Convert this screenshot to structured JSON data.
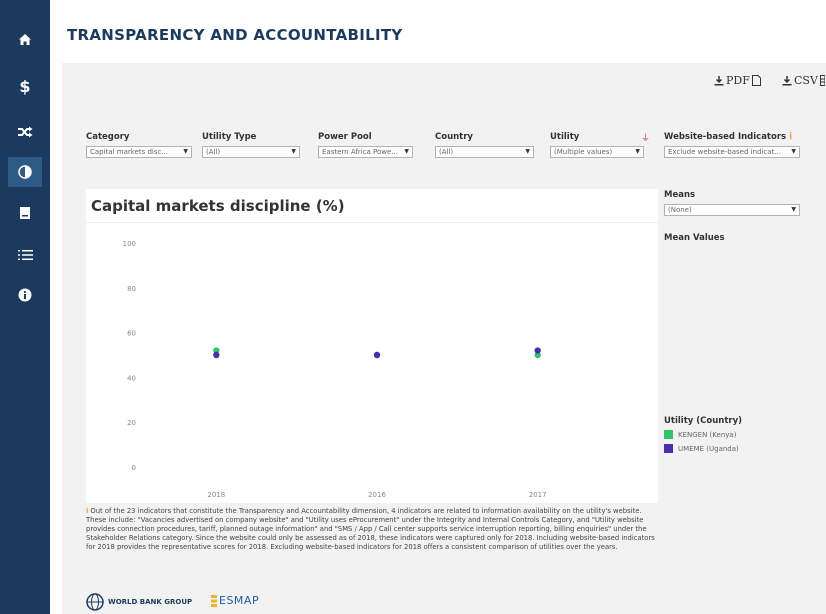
{
  "sidebar": {
    "items": [
      {
        "name": "home-icon",
        "active": false
      },
      {
        "name": "dollar-icon",
        "active": false
      },
      {
        "name": "shuffle-icon",
        "active": false
      },
      {
        "name": "contrast-icon",
        "active": true
      },
      {
        "name": "document-icon",
        "active": false
      },
      {
        "name": "list-icon",
        "active": false
      },
      {
        "name": "info-icon",
        "active": false
      }
    ]
  },
  "page": {
    "title": "TRANSPARENCY AND ACCOUNTABILITY"
  },
  "export": {
    "pdf_label": "PDF",
    "csv_label": "CSV"
  },
  "filters": {
    "category": {
      "label": "Category",
      "value": "Capital markets disc..."
    },
    "utility_type": {
      "label": "Utility Type",
      "value": "(All)"
    },
    "power_pool": {
      "label": "Power Pool",
      "value": "Eastern Africa Powe..."
    },
    "country": {
      "label": "Country",
      "value": "(All)"
    },
    "utility": {
      "label": "Utility",
      "value": "(Multiple values)"
    },
    "website": {
      "label": "Website-based Indicators",
      "info": "i",
      "value": "Exclude website-based indicat..."
    },
    "means": {
      "label": "Means",
      "value": "(None)"
    }
  },
  "mean_values_label": "Mean Values",
  "legend": {
    "title": "Utility (Country)",
    "items": [
      {
        "label": "KENGEN (Kenya)",
        "color": "#2fc46b"
      },
      {
        "label": "UMEME (Uganda)",
        "color": "#4b2ea8"
      }
    ]
  },
  "chart_data": {
    "type": "scatter",
    "title": "Capital markets discipline (%)",
    "categories": [
      "2018",
      "2016",
      "2017"
    ],
    "ylim": [
      0,
      100
    ],
    "yticks": [
      0,
      20,
      40,
      60,
      80,
      100
    ],
    "grid": false,
    "series": [
      {
        "name": "KENGEN (Kenya)",
        "color": "#2fc46b",
        "values": [
          52,
          50,
          50
        ]
      },
      {
        "name": "UMEME (Uganda)",
        "color": "#4b2ea8",
        "values": [
          50,
          50,
          52
        ]
      }
    ]
  },
  "footnote": {
    "info": "i",
    "text": "Out of the 23 indicators that constitute the Transparency and Accountability dimension, 4 indicators are related to information availability on the utility's website. These include: \"Vacancies advertised on company website\" and \"Utility uses eProcurement\" under the Integrity and Internal Controls Category, and \"Utility website provides connection procedures, tariff, planned outage information\" and \"SMS / App / Call center supports service interruption reporting, billing enquiries\" under the Stakeholder Relations category. Since the website could only be assessed as of 2018, these indicators were captured only for 2018. Including website-based indicators for 2018 provides the representative scores for 2018. Excluding website-based indicators for 2018 offers a consistent comparison of utilities over the years."
  },
  "logos": {
    "wbg": "WORLD BANK GROUP",
    "esmap": "ESMAP"
  }
}
